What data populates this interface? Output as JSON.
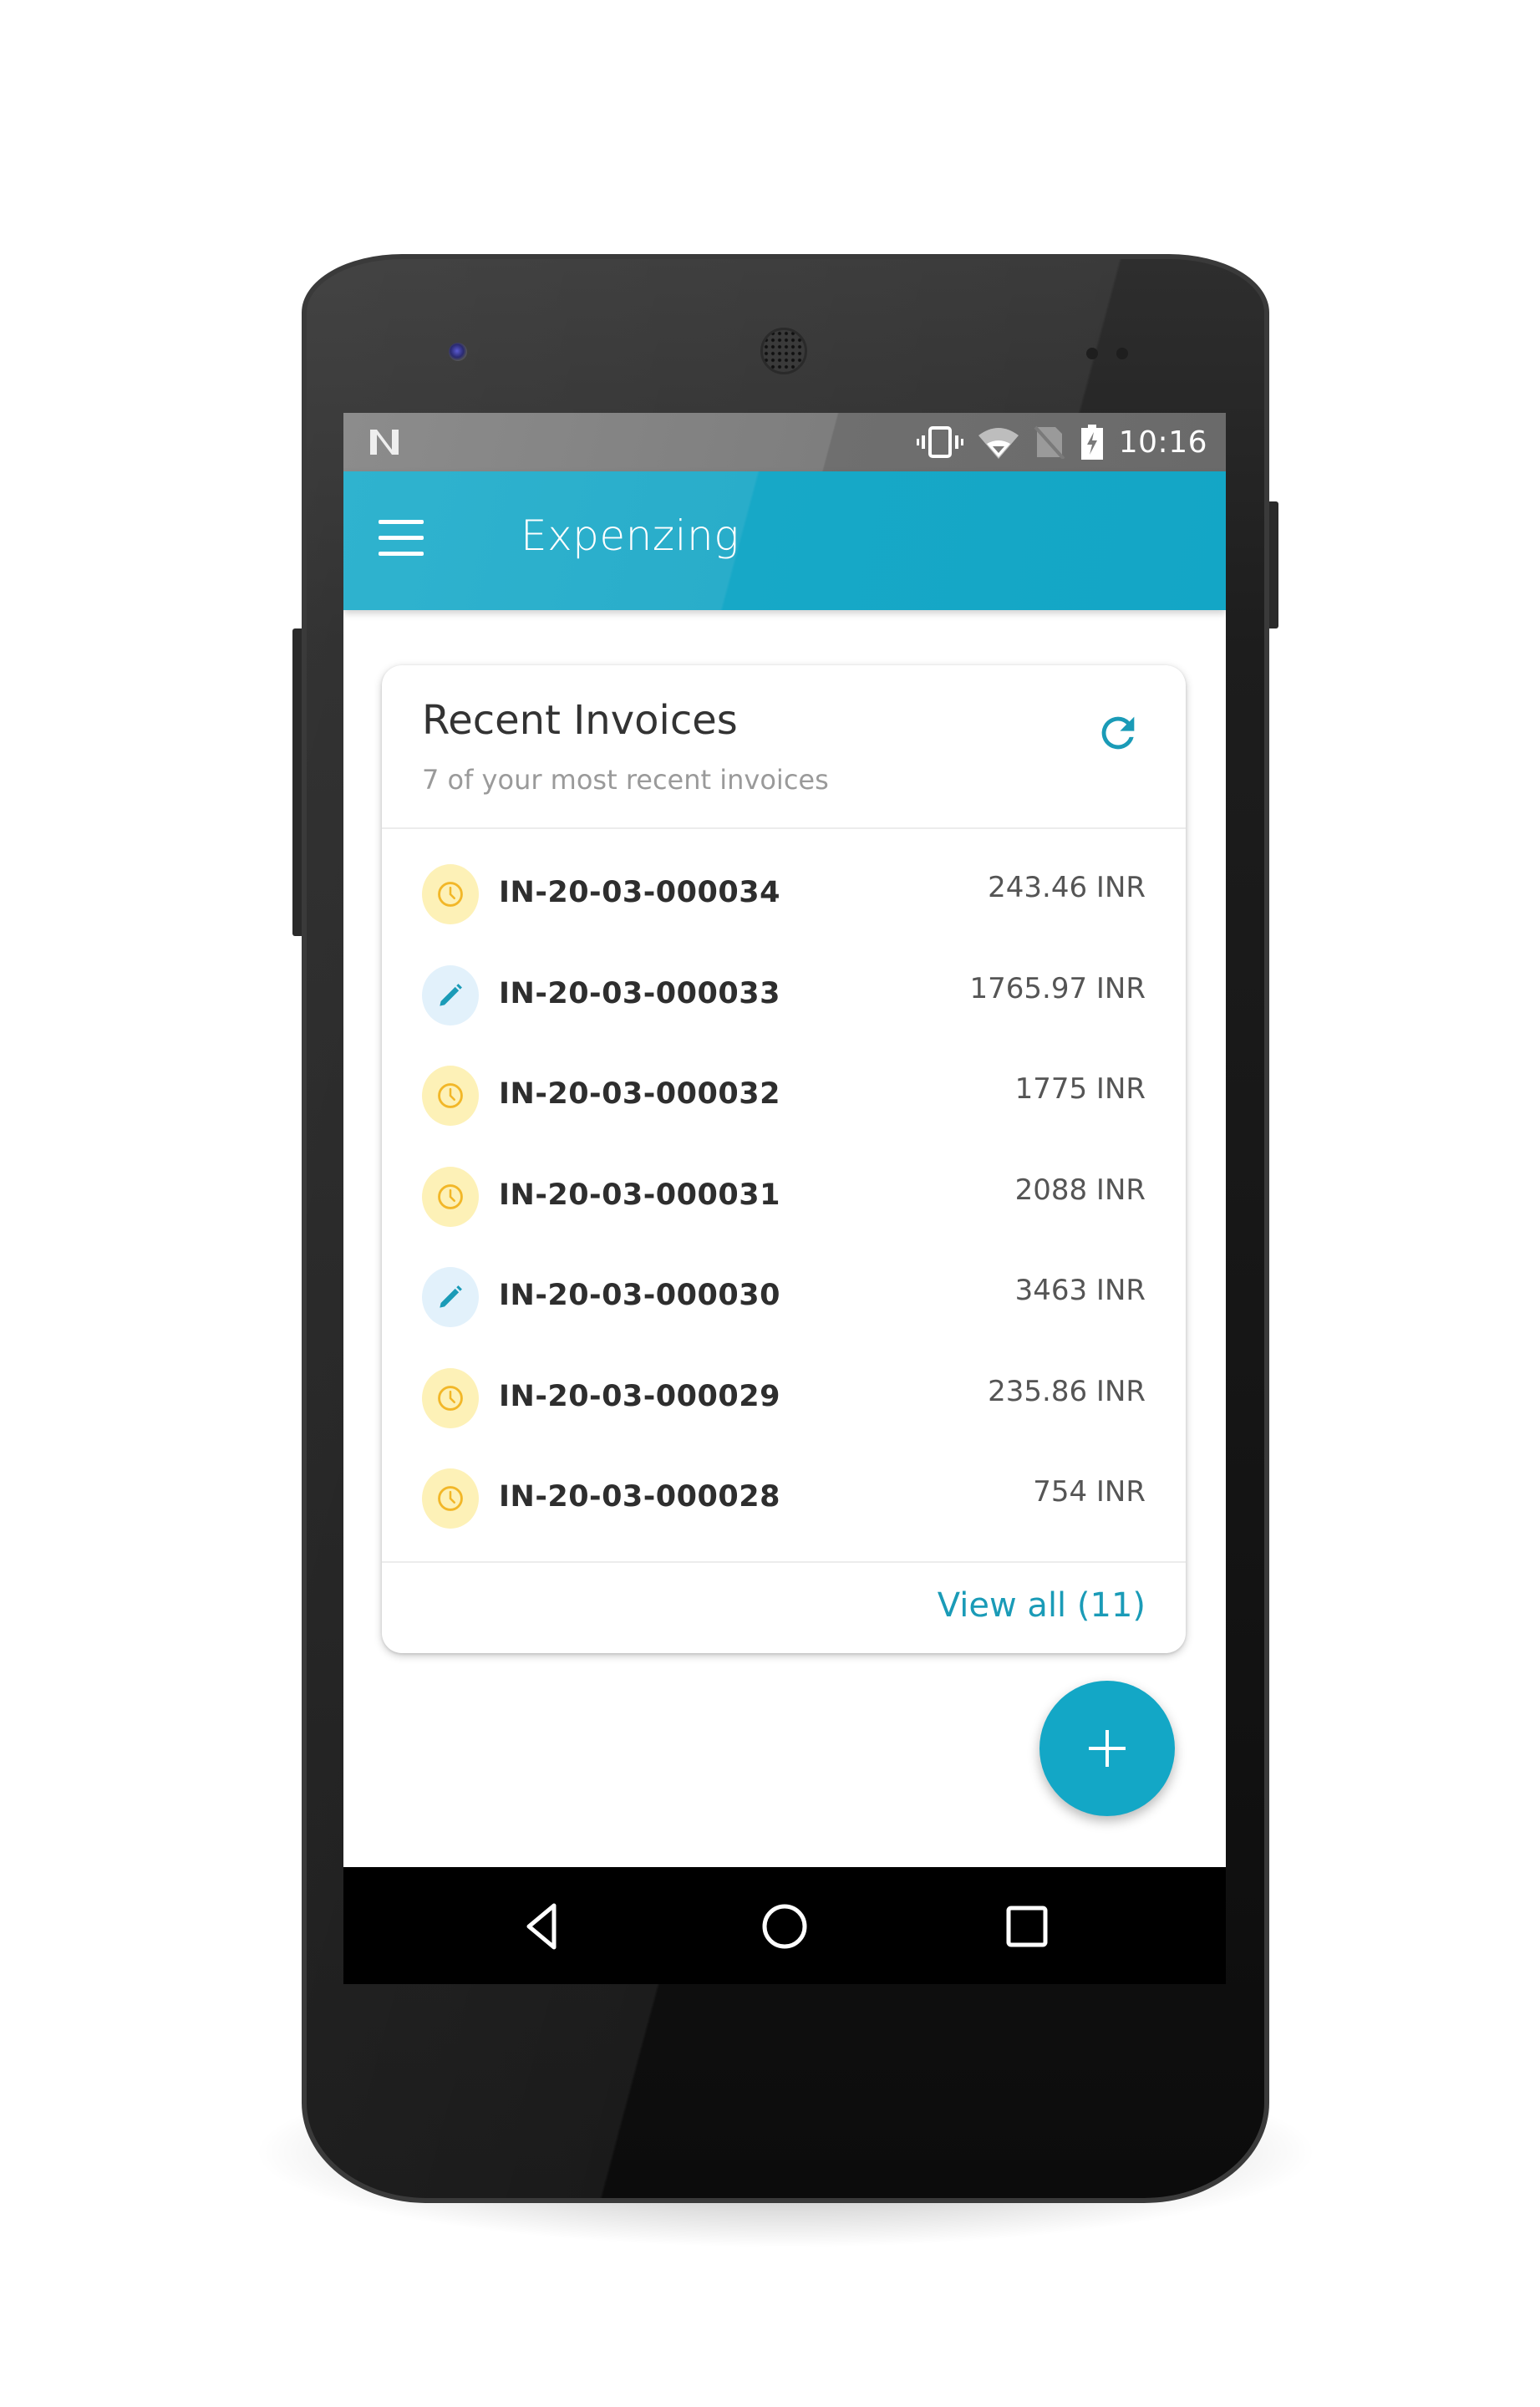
{
  "device": {
    "status_bar": {
      "time": "10:16",
      "icons": [
        "notification-n-icon",
        "vibrate-icon",
        "wifi-icon",
        "no-sim-icon",
        "battery-charging-icon"
      ]
    },
    "nav_bar": {
      "buttons": [
        "back",
        "home",
        "recents"
      ]
    }
  },
  "app_bar": {
    "title": "Expenzing",
    "menu_icon": "hamburger-menu-icon"
  },
  "card": {
    "title": "Recent Invoices",
    "subtitle": "7 of your most recent invoices",
    "refresh_icon": "refresh-icon",
    "invoices": [
      {
        "id": "IN-20-03-000034",
        "amount": "243.46 INR",
        "status": "pending",
        "icon": "clock-icon"
      },
      {
        "id": "IN-20-03-000033",
        "amount": "1765.97 INR",
        "status": "draft",
        "icon": "pencil-icon"
      },
      {
        "id": "IN-20-03-000032",
        "amount": "1775 INR",
        "status": "pending",
        "icon": "clock-icon"
      },
      {
        "id": "IN-20-03-000031",
        "amount": "2088 INR",
        "status": "pending",
        "icon": "clock-icon"
      },
      {
        "id": "IN-20-03-000030",
        "amount": "3463 INR",
        "status": "draft",
        "icon": "pencil-icon"
      },
      {
        "id": "IN-20-03-000029",
        "amount": "235.86 INR",
        "status": "pending",
        "icon": "clock-icon"
      },
      {
        "id": "IN-20-03-000028",
        "amount": "754 INR",
        "status": "pending",
        "icon": "clock-icon"
      }
    ],
    "view_all_label": "View all (11)"
  },
  "fab": {
    "icon": "plus-icon"
  },
  "colors": {
    "accent": "#13a7c6",
    "app_bar": "#17a8c7",
    "pending_bg": "#fdf1b7",
    "pending_fg": "#f2b728",
    "draft_bg": "#e2f1fb",
    "draft_fg": "#1a9bb7",
    "link": "#1a9bb7"
  }
}
